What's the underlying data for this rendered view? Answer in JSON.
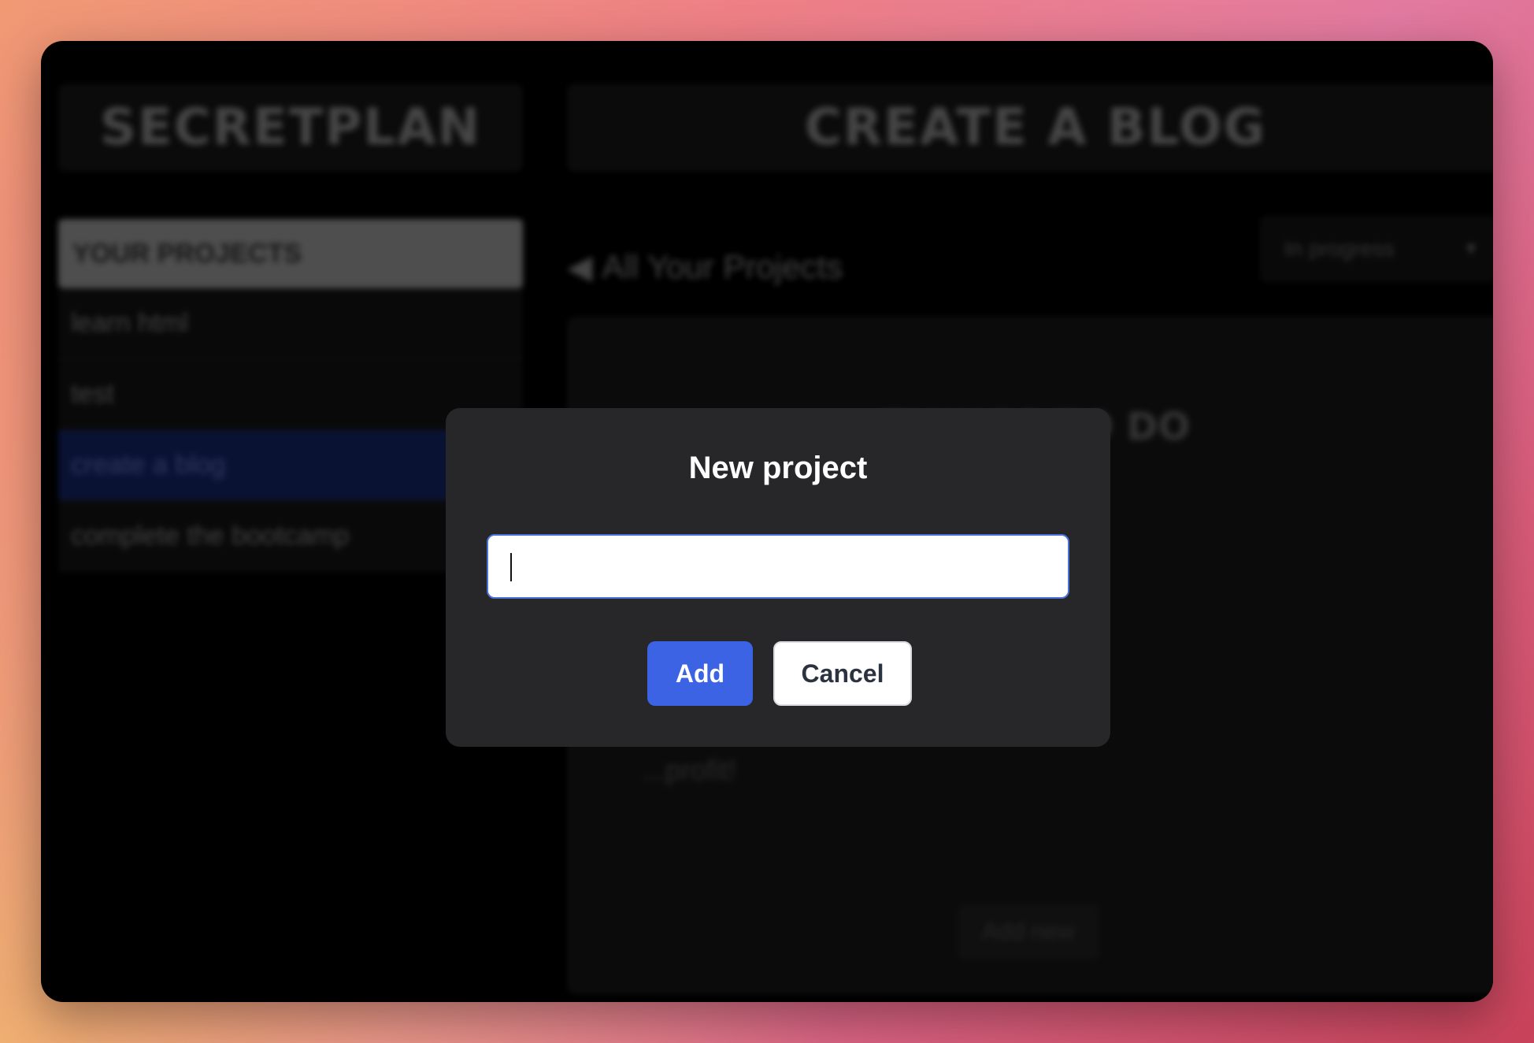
{
  "app": {
    "logo": "SECRETPLAN",
    "project_title": "CREATE A BLOG"
  },
  "sidebar": {
    "header": "YOUR PROJECTS",
    "items": [
      {
        "label": "learn html"
      },
      {
        "label": "test"
      },
      {
        "label": "create a blog",
        "active": true
      },
      {
        "label": "complete the bootcamp"
      }
    ]
  },
  "main": {
    "back_link": "All Your Projects",
    "status_select": "In progress",
    "panel_title": "THINGS TO DO",
    "panel_item": "...profit!",
    "add_new": "Add new"
  },
  "modal": {
    "title": "New project",
    "input_value": "",
    "add_label": "Add",
    "cancel_label": "Cancel"
  },
  "colors": {
    "accent": "#3b63e3",
    "modal_bg": "#27272a",
    "active_item": "#0b1438"
  },
  "icons": {
    "back": "triangle-left-icon",
    "select": "chevron-down-icon",
    "caret": "text-caret"
  }
}
